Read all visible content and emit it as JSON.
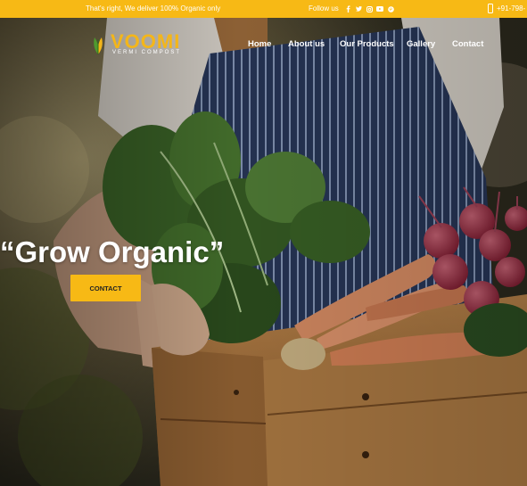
{
  "topbar": {
    "tagline": "That's right, We deliver 100% Organic only",
    "follow_label": "Follow us",
    "social_icons": [
      "facebook-icon",
      "twitter-icon",
      "instagram-icon",
      "youtube-icon",
      "pinterest-icon"
    ],
    "phone_icon": "phone-icon",
    "phone": "+91-798-"
  },
  "brand": {
    "name": "VOOMI",
    "tagline": "VERMI COMPOST",
    "logo_icon": "wheat-leaf-icon"
  },
  "nav": {
    "items": [
      "Home",
      "About us",
      "Our Products",
      "Gallery",
      "Contact"
    ]
  },
  "hero": {
    "headline": "“Grow Organic”",
    "cta_label": "CONTACT"
  },
  "colors": {
    "accent": "#f7b915",
    "text_light": "#ffffff"
  }
}
